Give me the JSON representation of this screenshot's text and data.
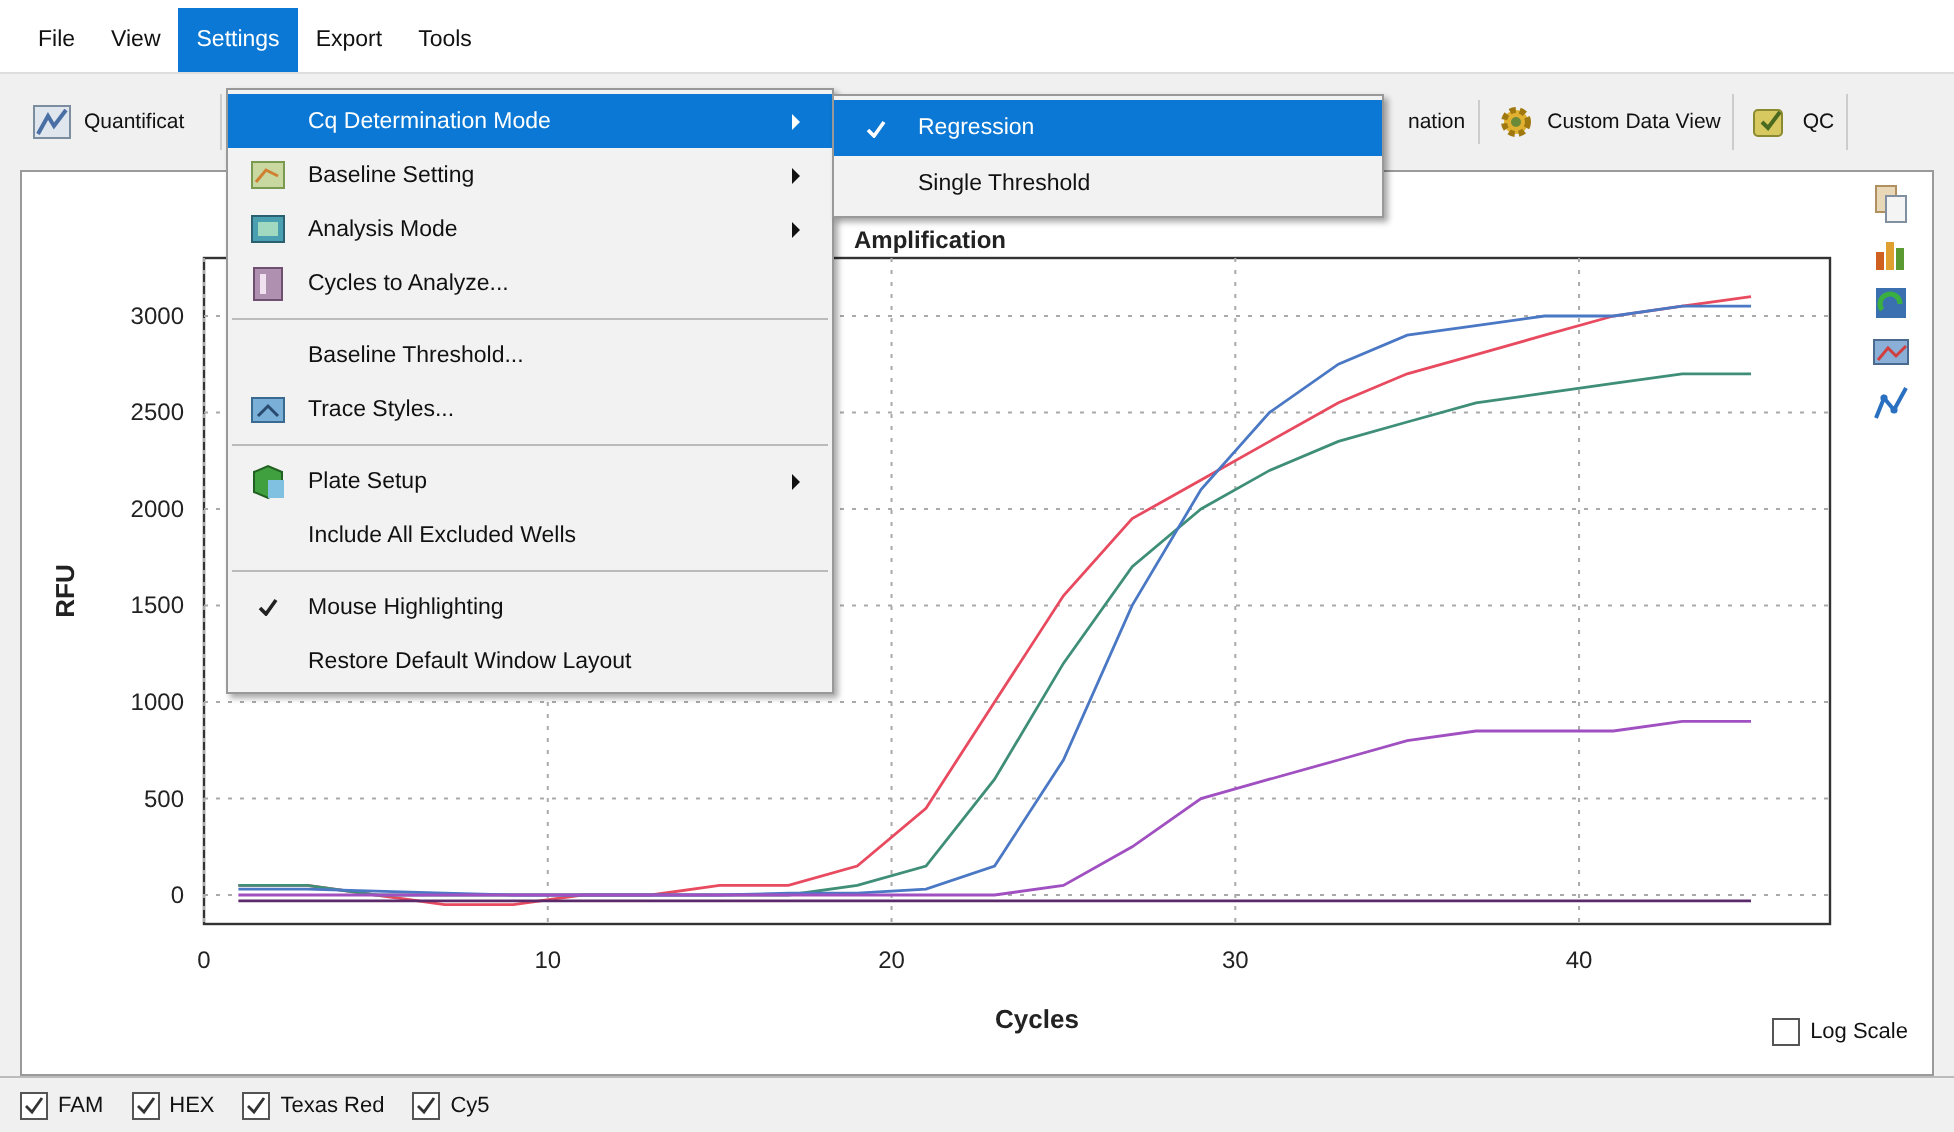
{
  "menu_bar": [
    {
      "label": "File",
      "selected": false
    },
    {
      "label": "View",
      "selected": false
    },
    {
      "label": "Settings",
      "selected": true
    },
    {
      "label": "Export",
      "selected": false
    },
    {
      "label": "Tools",
      "selected": false
    }
  ],
  "tabs": [
    {
      "label": "Quantificat",
      "kind": "chart"
    },
    {
      "label": "nation",
      "kind": "none"
    },
    {
      "label": "Custom Data View",
      "kind": "gear"
    },
    {
      "label": "QC",
      "kind": "qc"
    }
  ],
  "settings_menu": [
    {
      "kind": "item",
      "label": "Cq Determination Mode",
      "has_icon": false,
      "submenu": true,
      "checked": false,
      "selected": true
    },
    {
      "kind": "item",
      "label": "Baseline Setting",
      "has_icon": true,
      "submenu": true,
      "checked": false,
      "selected": false
    },
    {
      "kind": "item",
      "label": "Analysis Mode",
      "has_icon": true,
      "submenu": true,
      "checked": false,
      "selected": false
    },
    {
      "kind": "item",
      "label": "Cycles to Analyze...",
      "has_icon": true,
      "submenu": false,
      "checked": false,
      "selected": false
    },
    {
      "kind": "separator"
    },
    {
      "kind": "item",
      "label": "Baseline Threshold...",
      "has_icon": false,
      "submenu": false,
      "checked": false,
      "selected": false
    },
    {
      "kind": "item",
      "label": "Trace Styles...",
      "has_icon": true,
      "submenu": false,
      "checked": false,
      "selected": false
    },
    {
      "kind": "separator"
    },
    {
      "kind": "item",
      "label": "Plate Setup",
      "has_icon": true,
      "submenu": true,
      "checked": false,
      "selected": false
    },
    {
      "kind": "item",
      "label": "Include All Excluded Wells",
      "has_icon": false,
      "submenu": false,
      "checked": false,
      "selected": false
    },
    {
      "kind": "separator"
    },
    {
      "kind": "item",
      "label": "Mouse Highlighting",
      "has_icon": false,
      "submenu": false,
      "checked": true,
      "selected": false
    },
    {
      "kind": "item",
      "label": "Restore Default Window Layout",
      "has_icon": false,
      "submenu": false,
      "checked": false,
      "selected": false
    }
  ],
  "submenu": [
    {
      "label": "Regression",
      "checked": true,
      "selected": true
    },
    {
      "label": "Single Threshold",
      "checked": false,
      "selected": false
    }
  ],
  "chart": {
    "chart_data": {
      "type": "line",
      "title": "Amplification",
      "xlabel": "Cycles",
      "ylabel": "RFU",
      "grid": true,
      "x": [
        1,
        3,
        5,
        7,
        9,
        11,
        13,
        15,
        17,
        19,
        21,
        23,
        25,
        27,
        29,
        31,
        33,
        35,
        37,
        39,
        41,
        43,
        45
      ],
      "series": [
        {
          "color": "#e84a5f",
          "values": [
            50,
            50,
            0,
            -50,
            -50,
            0,
            0,
            50,
            50,
            150,
            450,
            1000,
            1550,
            1950,
            2150,
            2350,
            2550,
            2700,
            2800,
            2900,
            3000,
            3050,
            3100
          ]
        },
        {
          "color": "#3f8f78",
          "values": [
            50,
            50,
            0,
            0,
            0,
            0,
            0,
            0,
            0,
            50,
            150,
            600,
            1200,
            1700,
            2000,
            2200,
            2350,
            2450,
            2550,
            2600,
            2650,
            2700,
            2700
          ]
        },
        {
          "color": "#4a78c4",
          "values": [
            30,
            30,
            20,
            10,
            0,
            0,
            0,
            0,
            10,
            10,
            30,
            150,
            700,
            1500,
            2100,
            2500,
            2750,
            2900,
            2950,
            3000,
            3000,
            3050,
            3050
          ]
        },
        {
          "color": "#a050c0",
          "values": [
            0,
            0,
            0,
            0,
            0,
            0,
            0,
            0,
            0,
            0,
            0,
            0,
            50,
            250,
            500,
            600,
            700,
            800,
            850,
            850,
            850,
            900,
            900
          ]
        },
        {
          "color": "#5a2a6a",
          "values": [
            -30,
            -30,
            -30,
            -30,
            -30,
            -30,
            -30,
            -30,
            -30,
            -30,
            -30,
            -30,
            -30,
            -30,
            -30,
            -30,
            -30,
            -30,
            -30,
            -30,
            -30,
            -30,
            -30
          ]
        }
      ],
      "xlim": [
        0,
        47.3
      ],
      "ylim": [
        -150,
        3300
      ],
      "xticks": [
        0,
        10,
        20,
        30,
        40
      ],
      "yticks": [
        0,
        500,
        1000,
        1500,
        2000,
        2500,
        3000
      ]
    }
  },
  "log_scale": {
    "label": "Log Scale",
    "checked": false
  },
  "dyes": [
    {
      "label": "FAM",
      "checked": true
    },
    {
      "label": "HEX",
      "checked": true
    },
    {
      "label": "Texas Red",
      "checked": true
    },
    {
      "label": "Cy5",
      "checked": true
    }
  ]
}
